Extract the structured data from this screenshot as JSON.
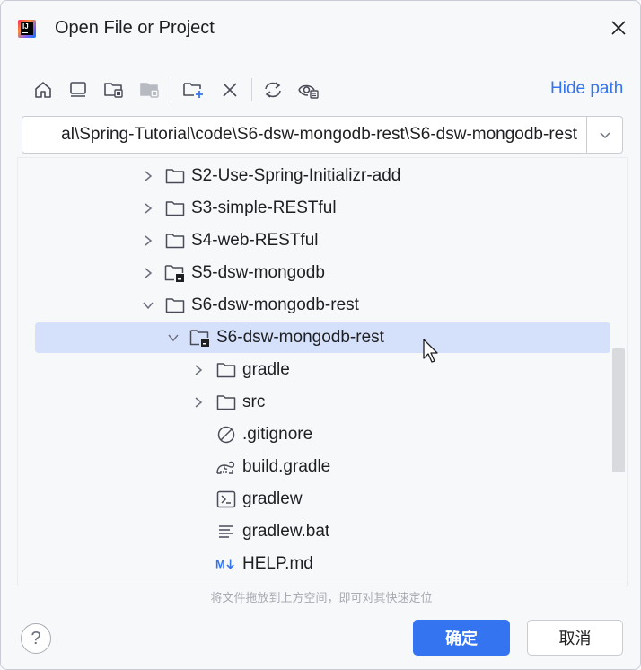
{
  "window": {
    "title": "Open File or Project"
  },
  "toolbar": {
    "buttons": [
      {
        "name": "home-icon"
      },
      {
        "name": "desktop-icon"
      },
      {
        "name": "project-folder-icon"
      },
      {
        "name": "module-folder-icon"
      },
      {
        "name": "new-folder-icon"
      },
      {
        "name": "delete-icon"
      },
      {
        "name": "refresh-icon"
      },
      {
        "name": "show-hidden-icon"
      }
    ],
    "hide_path_label": "Hide path"
  },
  "path": {
    "value": "al\\Spring-Tutorial\\code\\S6-dsw-mongodb-rest\\S6-dsw-mongodb-rest"
  },
  "tree": {
    "items": [
      {
        "label": "S2-Use-Spring-Initializr-add",
        "icon": "folder-icon",
        "expand": "collapsed",
        "level": 0
      },
      {
        "label": "S3-simple-RESTful",
        "icon": "folder-icon",
        "expand": "collapsed",
        "level": 0
      },
      {
        "label": "S4-web-RESTful",
        "icon": "folder-icon",
        "expand": "collapsed",
        "level": 0
      },
      {
        "label": "S5-dsw-mongodb",
        "icon": "project-folder-icon",
        "expand": "collapsed",
        "level": 0
      },
      {
        "label": "S6-dsw-mongodb-rest",
        "icon": "folder-icon",
        "expand": "expanded",
        "level": 0
      },
      {
        "label": "S6-dsw-mongodb-rest",
        "icon": "project-folder-icon",
        "expand": "expanded",
        "level": 1,
        "selected": true
      },
      {
        "label": "gradle",
        "icon": "folder-icon",
        "expand": "collapsed",
        "level": 2
      },
      {
        "label": "src",
        "icon": "folder-icon",
        "expand": "collapsed",
        "level": 2
      },
      {
        "label": ".gitignore",
        "icon": "ignore-file-icon",
        "expand": "none",
        "level": 2
      },
      {
        "label": "build.gradle",
        "icon": "gradle-file-icon",
        "expand": "none",
        "level": 2
      },
      {
        "label": "gradlew",
        "icon": "shell-script-icon",
        "expand": "none",
        "level": 2
      },
      {
        "label": "gradlew.bat",
        "icon": "text-file-icon",
        "expand": "none",
        "level": 2
      },
      {
        "label": "HELP.md",
        "icon": "markdown-file-icon",
        "expand": "none",
        "level": 2
      }
    ]
  },
  "drop_hint": "将文件拖放到上方空间，即可对其快速定位",
  "buttons": {
    "help": "?",
    "ok": "确定",
    "cancel": "取消"
  },
  "colors": {
    "accent": "#3574f0",
    "selection": "#d5e1fb",
    "background": "#f7f8fa"
  }
}
